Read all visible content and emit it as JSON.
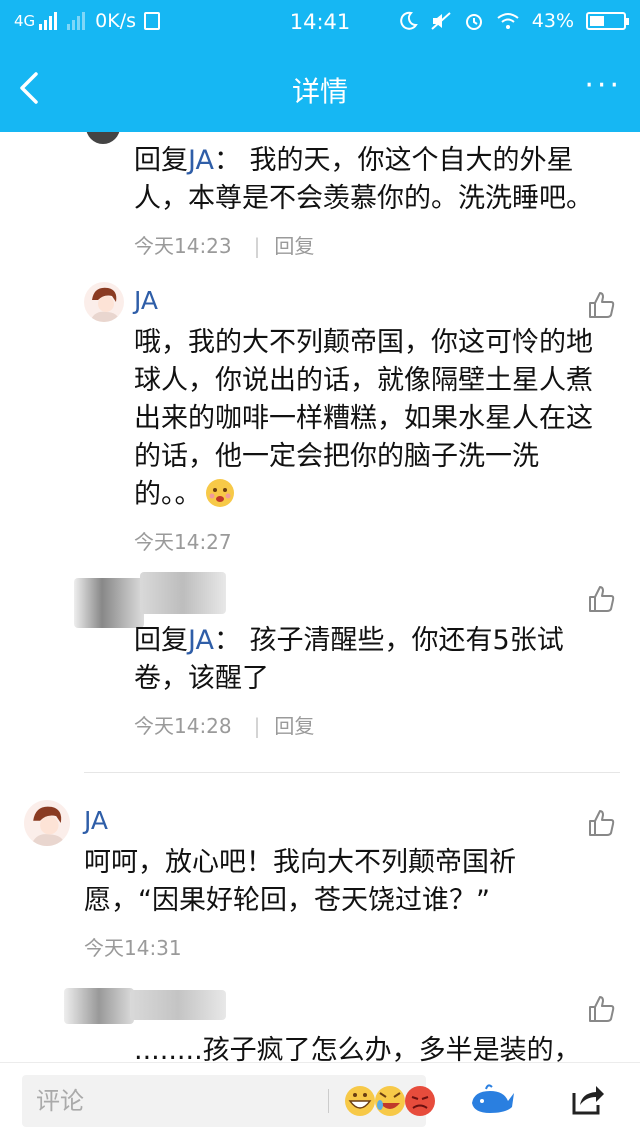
{
  "status_bar": {
    "network": "4G",
    "speed": "0K/s",
    "time": "14:41",
    "battery": "43%",
    "battery_level": 0.43
  },
  "nav": {
    "title": "详情",
    "more": "···"
  },
  "colors": {
    "accent": "#16b7f3",
    "name_blue": "#2f5ea8",
    "meta_gray": "#9a9a9a"
  },
  "comments": [
    {
      "reply_prefix": "回复",
      "reply_to": "JA",
      "reply_sep": "：",
      "line1": " 我的天，你这个自大的外星",
      "line2": "人，本尊是不会羡慕你的。洗洗睡吧。",
      "time": "今天14:23",
      "reply_label": "回复"
    },
    {
      "name": "JA",
      "lines": [
        "哦，我的大不列颠帝国，你这可怜的地",
        "球人，你说出的话，就像隔壁土星人煮",
        "出来的咖啡一样糟糕，如果水星人在这",
        "的话，他一定会把你的脑子洗一洗",
        "的。。"
      ],
      "time": "今天14:27"
    },
    {
      "reply_prefix": "回复",
      "reply_to": "JA",
      "reply_sep": "：",
      "line1": " 孩子清醒些，你还有5张试",
      "line2": "卷，该醒了",
      "time": "今天14:28",
      "reply_label": "回复"
    },
    {
      "name": "JA",
      "lines": [
        "呵呵，放心吧！我向大不列颠帝国祈",
        "愿，“因果好轮回，苍天饶过谁？”"
      ],
      "time": "今天14:31"
    },
    {
      "line1": "........孩子疯了怎么办，多半是装的，"
    }
  ],
  "bottom_bar": {
    "placeholder": "评论"
  },
  "icons": {
    "back": "back-arrow-icon",
    "more": "more-icon",
    "like": "thumbs-up-icon",
    "emoji": "emoji-icon",
    "favorite": "whale-icon",
    "share": "share-icon"
  }
}
